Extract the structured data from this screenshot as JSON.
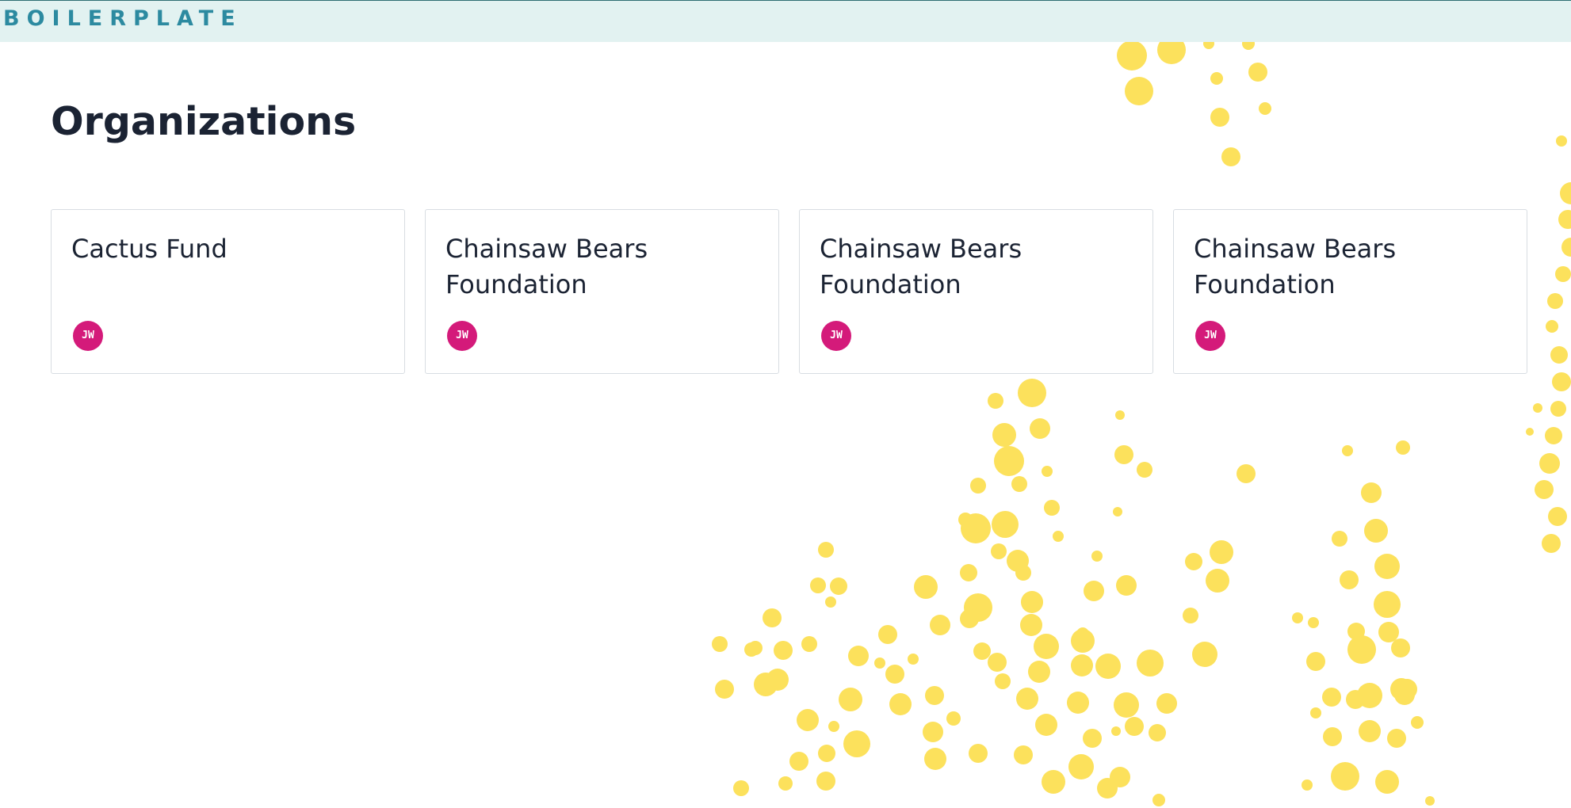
{
  "header": {
    "logo_text": "BOILERPLATE"
  },
  "main": {
    "title": "Organizations",
    "organizations": [
      {
        "name": "Cactus Fund",
        "member_initials": "JW"
      },
      {
        "name": "Chainsaw Bears Foundation",
        "member_initials": "JW"
      },
      {
        "name": "Chainsaw Bears Foundation",
        "member_initials": "JW"
      },
      {
        "name": "Chainsaw Bears Foundation",
        "member_initials": "JW"
      }
    ]
  },
  "colors": {
    "header_background": "#e2f2f1",
    "logo": "#2c8aa0",
    "title_text": "#1b2333",
    "card_border": "#d8dde2",
    "avatar": "#d41a7a",
    "decoration": "#fce15c"
  }
}
